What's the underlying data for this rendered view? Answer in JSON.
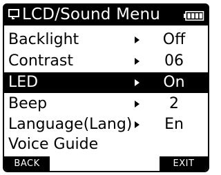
{
  "header": {
    "title": "LCD/Sound Menu",
    "menu_icon": "menu-speech-icon",
    "battery_icon": "battery-full-icon"
  },
  "menu": {
    "items": [
      {
        "label": "Backlight",
        "value": "Off",
        "has_arrow": true,
        "selected": false
      },
      {
        "label": "Contrast",
        "value": "06",
        "has_arrow": true,
        "selected": false
      },
      {
        "label": "LED",
        "value": "On",
        "has_arrow": true,
        "selected": true
      },
      {
        "label": "Beep",
        "value": "2",
        "has_arrow": true,
        "selected": false
      },
      {
        "label": "Language(Lang)",
        "value": "En",
        "has_arrow": true,
        "selected": false
      },
      {
        "label": "Voice Guide",
        "value": "",
        "has_arrow": false,
        "selected": false
      }
    ]
  },
  "footer": {
    "back_label": "BACK",
    "exit_label": "EXIT"
  },
  "colors": {
    "background": "#ffffff",
    "foreground": "#000000"
  }
}
